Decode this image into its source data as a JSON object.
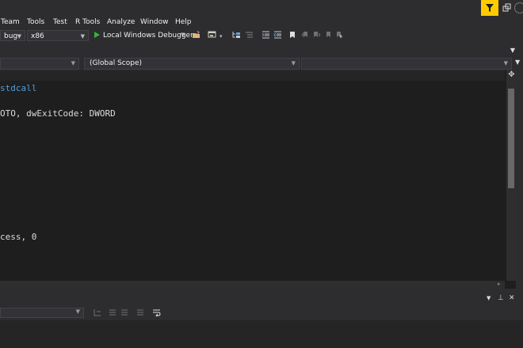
{
  "menu": {
    "items": [
      "Team",
      "Tools",
      "Test",
      "R Tools",
      "Analyze",
      "Window",
      "Help"
    ]
  },
  "toolbar": {
    "config_value": "bug",
    "platform_value": "x86",
    "run_label": "Local Windows Debugger"
  },
  "navbar": {
    "scope_value": "(Global Scope)"
  },
  "code": {
    "lines": [
      "stdcall",
      "",
      "OTO, dwExitCode: DWORD",
      "",
      "",
      "",
      "",
      "",
      "",
      "",
      "",
      "cess, 0"
    ]
  },
  "icons": {
    "filter": "filter-funnel-icon",
    "accent": "#ffcc00"
  },
  "colors": {
    "background": "#1e1e1e",
    "chrome": "#2d2d30",
    "keyword": "#569cd6",
    "run_green": "#35b335"
  }
}
